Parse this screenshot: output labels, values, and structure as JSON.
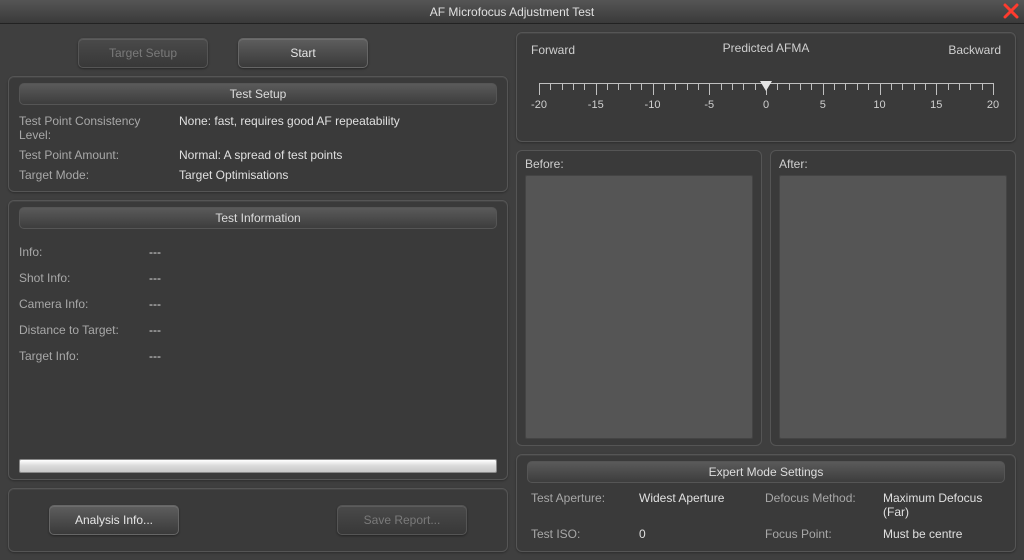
{
  "window": {
    "title": "AF Microfocus Adjustment Test"
  },
  "buttons": {
    "target_setup": "Target Setup",
    "start": "Start",
    "analysis_info": "Analysis Info...",
    "save_report": "Save Report..."
  },
  "test_setup": {
    "header": "Test Setup",
    "rows": [
      {
        "k": "Test Point Consistency Level:",
        "v": "None: fast, requires good AF repeatability"
      },
      {
        "k": "Test Point Amount:",
        "v": "Normal: A spread of test points"
      },
      {
        "k": "Target Mode:",
        "v": "Target Optimisations"
      }
    ]
  },
  "test_info": {
    "header": "Test Information",
    "rows": [
      {
        "k": "Info:",
        "v": "---"
      },
      {
        "k": "Shot Info:",
        "v": "---"
      },
      {
        "k": "Camera Info:",
        "v": "---"
      },
      {
        "k": "Distance to Target:",
        "v": "---"
      },
      {
        "k": "Target Info:",
        "v": "---"
      }
    ]
  },
  "afma": {
    "left_label": "Forward",
    "center_label": "Predicted AFMA",
    "right_label": "Backward",
    "min": -20,
    "max": 20,
    "step": 5,
    "marker_value": 0,
    "ticks": [
      -20,
      -15,
      -10,
      -5,
      0,
      5,
      10,
      15,
      20
    ]
  },
  "previews": {
    "before": "Before:",
    "after": "After:"
  },
  "expert": {
    "header": "Expert Mode Settings",
    "test_aperture_k": "Test Aperture:",
    "test_aperture_v": "Widest Aperture",
    "defocus_method_k": "Defocus Method:",
    "defocus_method_v": "Maximum Defocus (Far)",
    "test_iso_k": "Test ISO:",
    "test_iso_v": "0",
    "focus_point_k": "Focus Point:",
    "focus_point_v": "Must be centre"
  }
}
